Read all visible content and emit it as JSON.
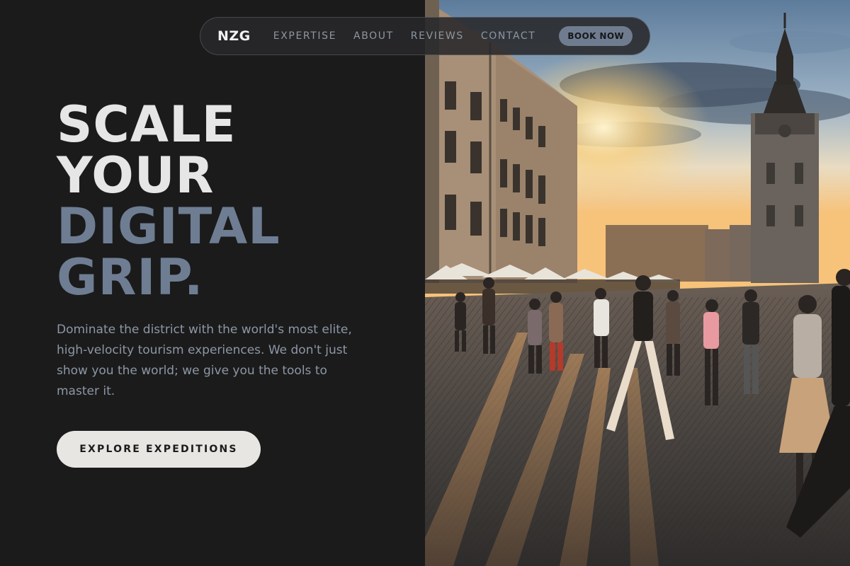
{
  "nav": {
    "brand": "NZG",
    "links": [
      "EXPERTISE",
      "ABOUT",
      "REVIEWS",
      "CONTACT"
    ],
    "book_label": "BOOK NOW"
  },
  "hero": {
    "headline_lines": [
      "SCALE",
      "YOUR",
      "DIGITAL",
      "GRIP."
    ],
    "description": "Dominate the district with the world's most elite, high-velocity tourism experiences. We don't just show you the world; we give you the tools to master it.",
    "cta_label": "EXPLORE EXPEDITIONS"
  },
  "colors": {
    "background": "#1b1b1c",
    "headline_light": "#e6e6e6",
    "headline_accent": "#6e7d92",
    "button_light": "#e8e6e3",
    "button_accent": "#6f7c8f"
  }
}
